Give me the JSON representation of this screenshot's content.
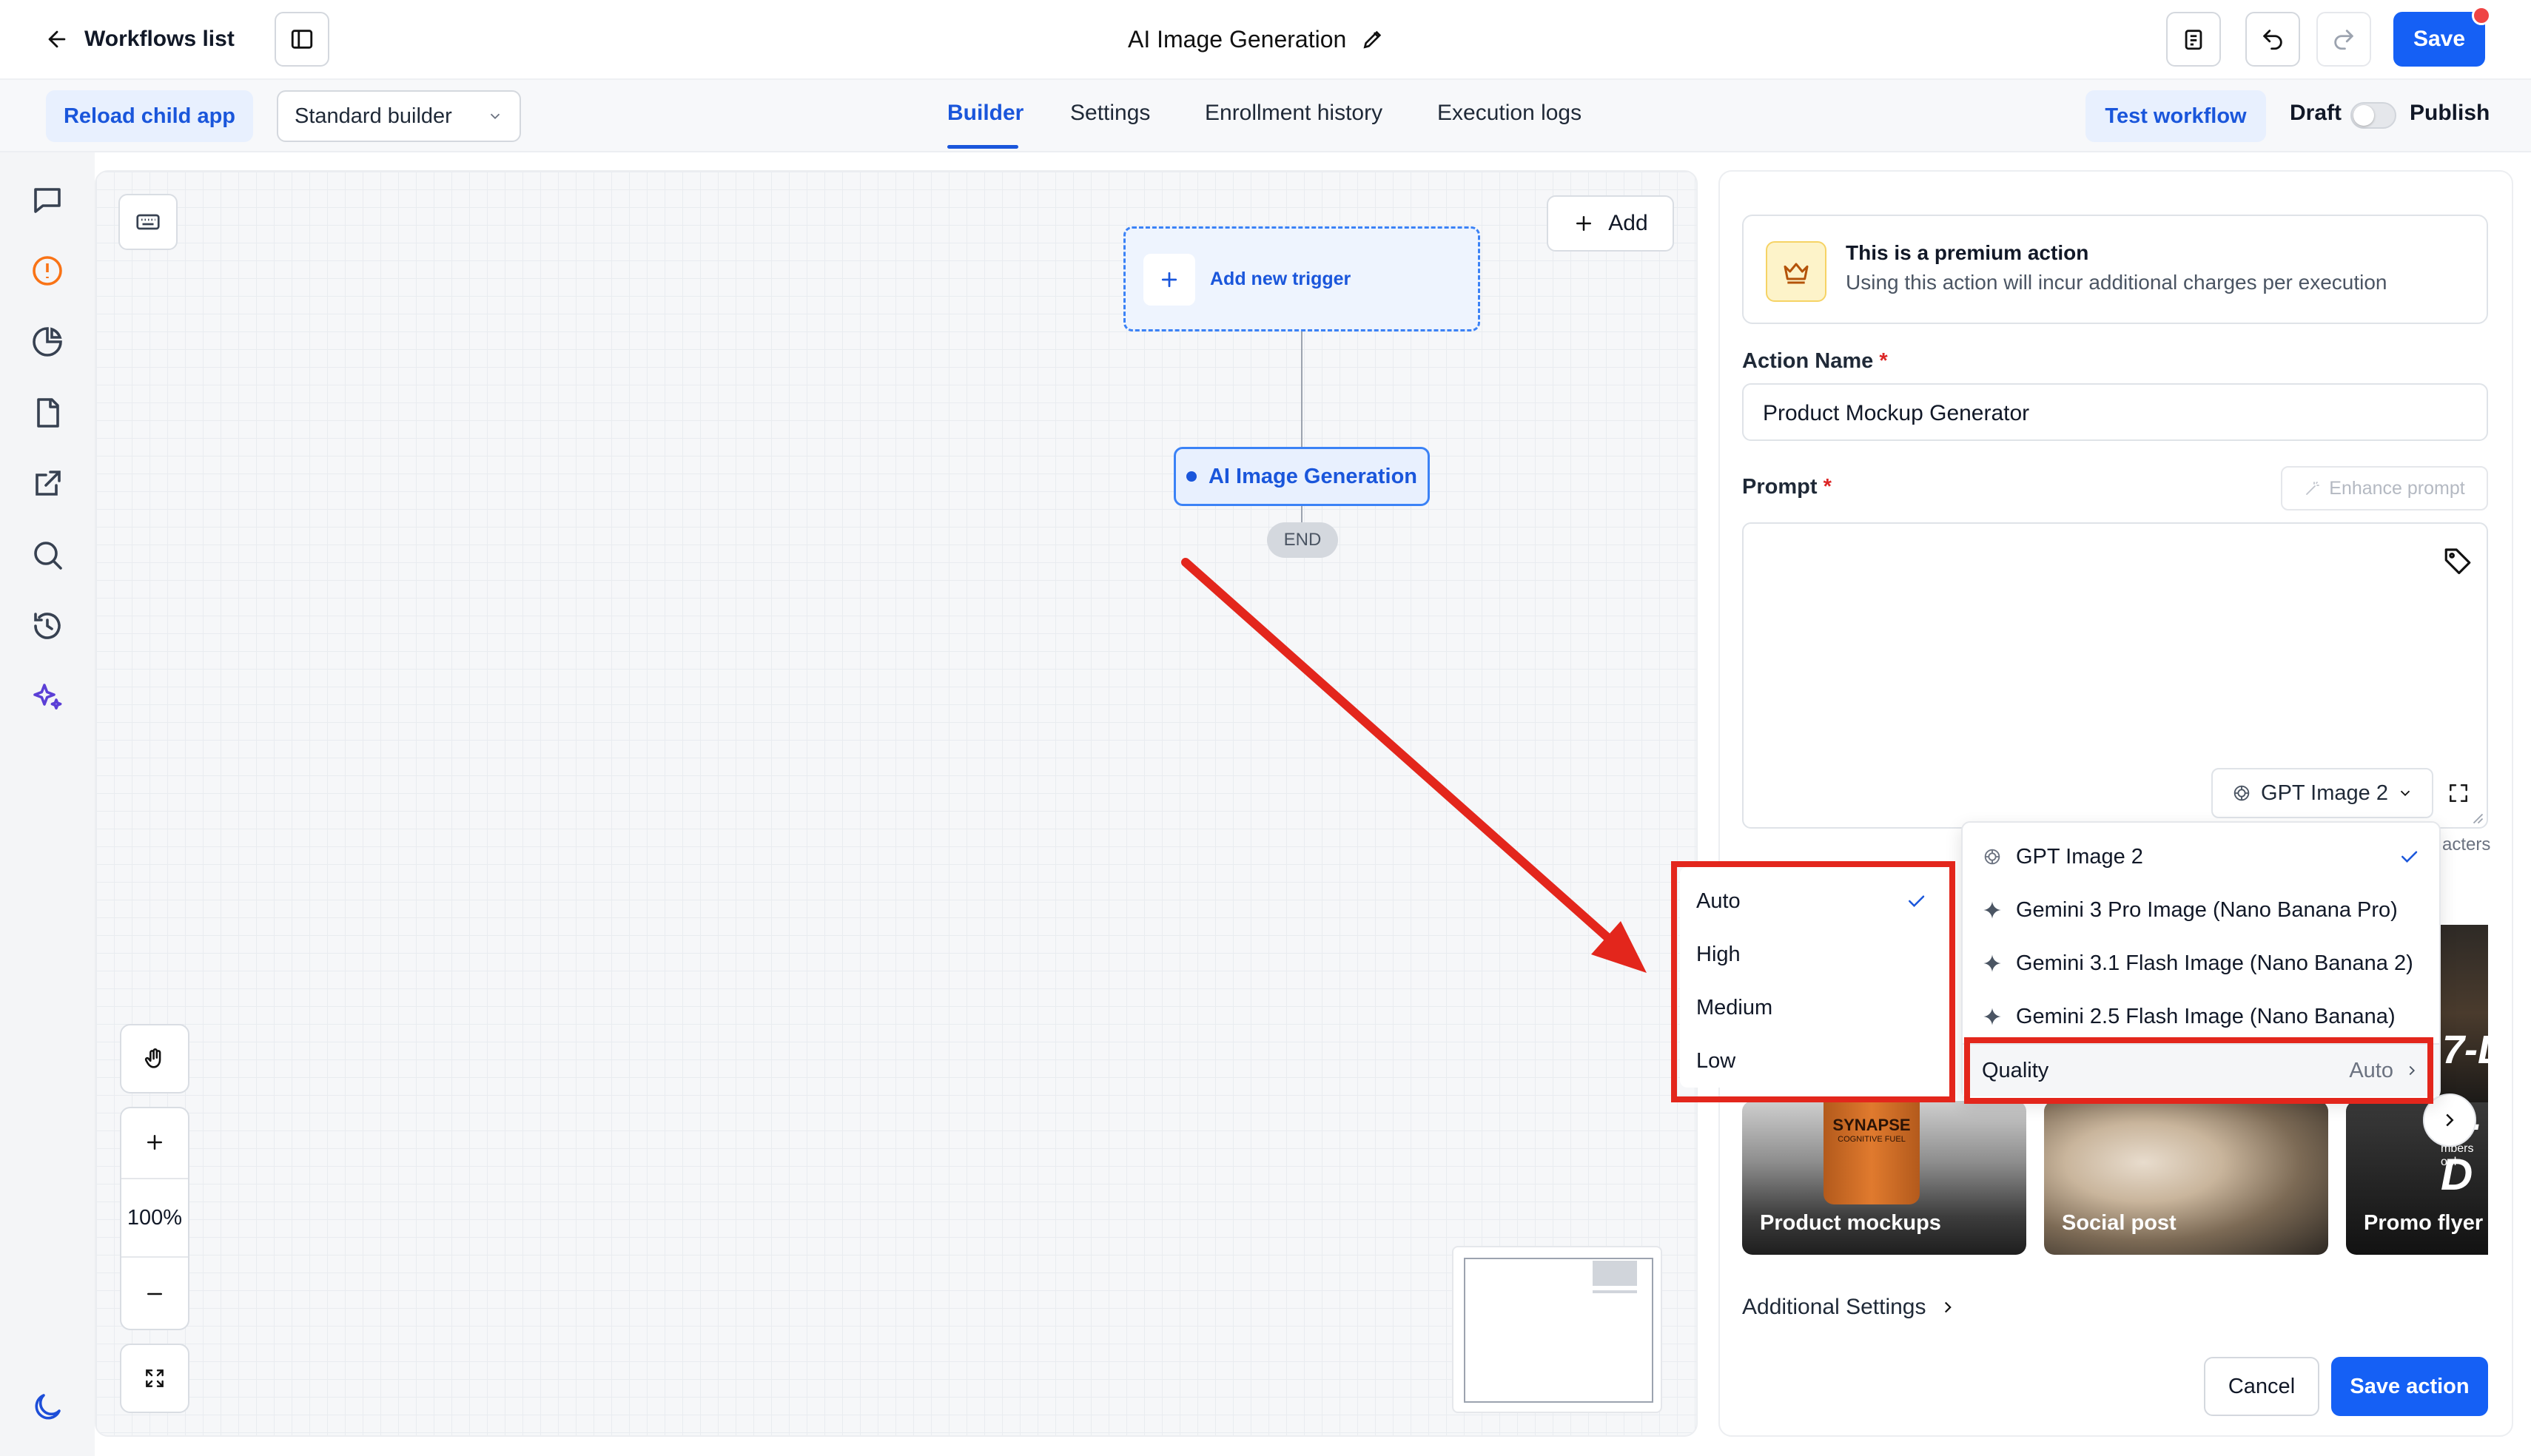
{
  "header": {
    "back_label": "Workflows list",
    "title": "AI Image Generation",
    "save_label": "Save"
  },
  "subbar": {
    "reload_label": "Reload child app",
    "builder_select": "Standard builder",
    "tabs": [
      "Builder",
      "Settings",
      "Enrollment history",
      "Execution logs"
    ],
    "test_label": "Test workflow",
    "draft_label": "Draft",
    "publish_label": "Publish"
  },
  "canvas": {
    "add_label": "Add",
    "trigger_label": "Add new trigger",
    "node_label": "AI Image Generation",
    "end_label": "END",
    "zoom_level": "100%"
  },
  "panel": {
    "premium_title": "This is a premium action",
    "premium_desc": "Using this action will incur additional charges per execution",
    "action_name_label": "Action Name",
    "action_name_value": "Product Mockup Generator",
    "prompt_label": "Prompt",
    "enhance_label": "Enhance prompt",
    "model_select": "GPT Image 2",
    "chars_fragment": "acters",
    "templates": [
      "Product mockups",
      "Social post",
      "Promo flyer"
    ],
    "additional_settings": "Additional Settings",
    "cancel_label": "Cancel",
    "save_action_label": "Save action"
  },
  "model_menu": {
    "items": [
      "GPT Image 2",
      "Gemini 3 Pro Image (Nano Banana Pro)",
      "Gemini 3.1 Flash Image (Nano Banana 2)",
      "Gemini 2.5 Flash Image (Nano Banana)"
    ],
    "quality_label": "Quality",
    "quality_value": "Auto"
  },
  "quality_menu": {
    "items": [
      "Auto",
      "High",
      "Medium",
      "Low"
    ],
    "selected": "Auto"
  },
  "template_texts": {
    "bottle_brand": "SYNAPSE",
    "bottle_sub": "COGNITIVE FUEL",
    "flyer_big": "7-D",
    "flyer_small": "mbers onl"
  },
  "colors": {
    "primary": "#1560f5",
    "primary_text": "#1a56db",
    "light_blue_bg": "#e8f0fe",
    "annotation_red": "#e3261c",
    "notification_red": "#ef4444"
  }
}
